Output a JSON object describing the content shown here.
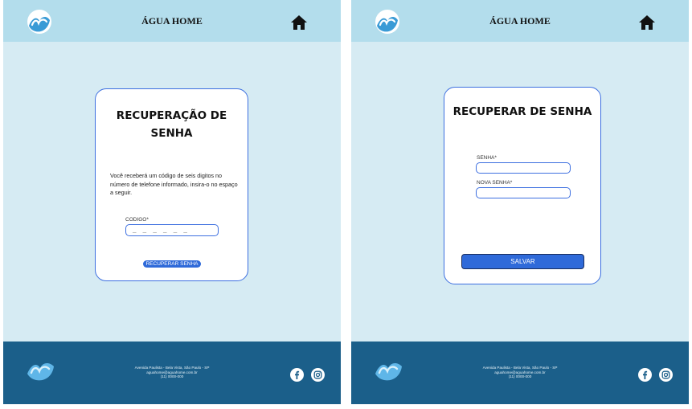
{
  "left_screen": {
    "header": {
      "brand": "ÁGUA HOME"
    },
    "card": {
      "title": "RECUPERAÇÃO DE SENHA",
      "description": "Você receberá um código de seis digitos no número de telefone informado, insira-o no espaço a seguir.",
      "code_label": "CODIGO*",
      "code_placeholder": "_ _ _ _ _ _",
      "button_label": "RECUPERAR SENHA"
    },
    "footer": {
      "address": "Avenida Paulista - Bela Vista, São Paulo - SP",
      "email": "aguahome@aguahome.com.br",
      "phone": "(11) 0000-000"
    }
  },
  "right_screen": {
    "header": {
      "brand": "ÁGUA HOME"
    },
    "card": {
      "title": "RECUPERAR DE SENHA",
      "senha_label": "SENHA*",
      "nova_senha_label": "NOVA SENHA*",
      "button_label": "SALVAR"
    },
    "footer": {
      "address": "Avenida Paulista - Bela Vista, São Paulo - SP",
      "email": "aguahome@aguahome.com.br",
      "phone": "(11) 0000-000"
    }
  },
  "icons": {
    "logo": "wave-logo-icon",
    "home": "home-icon",
    "facebook": "facebook-icon",
    "instagram": "instagram-icon"
  },
  "colors": {
    "header_bg": "#b3ddec",
    "page_bg": "#d6ebf3",
    "footer_bg": "#1b5f8a",
    "accent": "#2f6ad9"
  }
}
